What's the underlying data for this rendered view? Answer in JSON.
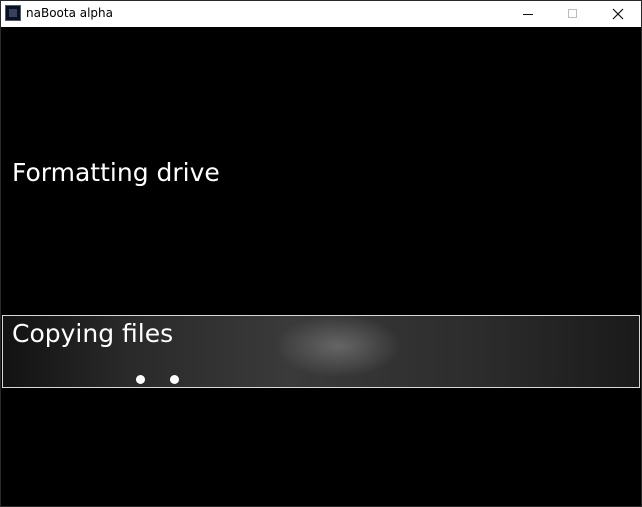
{
  "window": {
    "title": "naBoota alpha",
    "icon": "app-icon",
    "controls": {
      "minimize_icon": "minimize-icon",
      "maximize_icon": "maximize-icon",
      "close_icon": "close-icon"
    }
  },
  "steps": [
    {
      "label": "Formatting drive",
      "state": "pending"
    },
    {
      "label": "Copying files",
      "state": "active"
    }
  ],
  "colors": {
    "background": "#000000",
    "text": "#ffffff",
    "titlebar": "#ffffff",
    "active_border": "#d8d8d8"
  }
}
